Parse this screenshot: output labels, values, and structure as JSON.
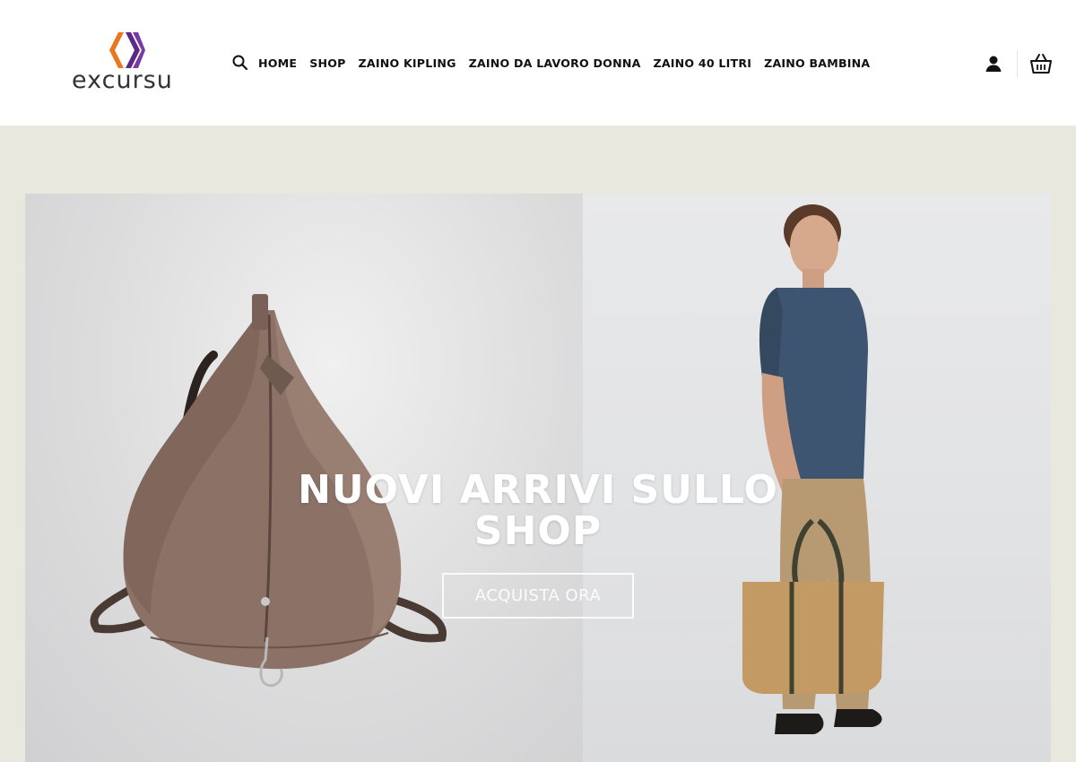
{
  "brand": {
    "name": "excursu",
    "colors": {
      "orange": "#e8781e",
      "purple": "#5b2a82",
      "text": "#333333"
    }
  },
  "nav": {
    "search_icon": "search-icon",
    "items": [
      {
        "label": "HOME"
      },
      {
        "label": "SHOP"
      },
      {
        "label": "ZAINO KIPLING"
      },
      {
        "label": "ZAINO DA LAVORO DONNA"
      },
      {
        "label": "ZAINO 40 LITRI"
      },
      {
        "label": "ZAINO BAMBINA"
      }
    ]
  },
  "header_actions": {
    "account_icon": "user-icon",
    "cart_icon": "basket-icon"
  },
  "hero": {
    "title": "NUOVI ARRIVI SULLO SHOP",
    "button_label": "ACQUISTA ORA",
    "left_image": "taupe-leather-backpack",
    "right_image": "man-with-tote-bag",
    "page_background": "#e9e8df"
  }
}
